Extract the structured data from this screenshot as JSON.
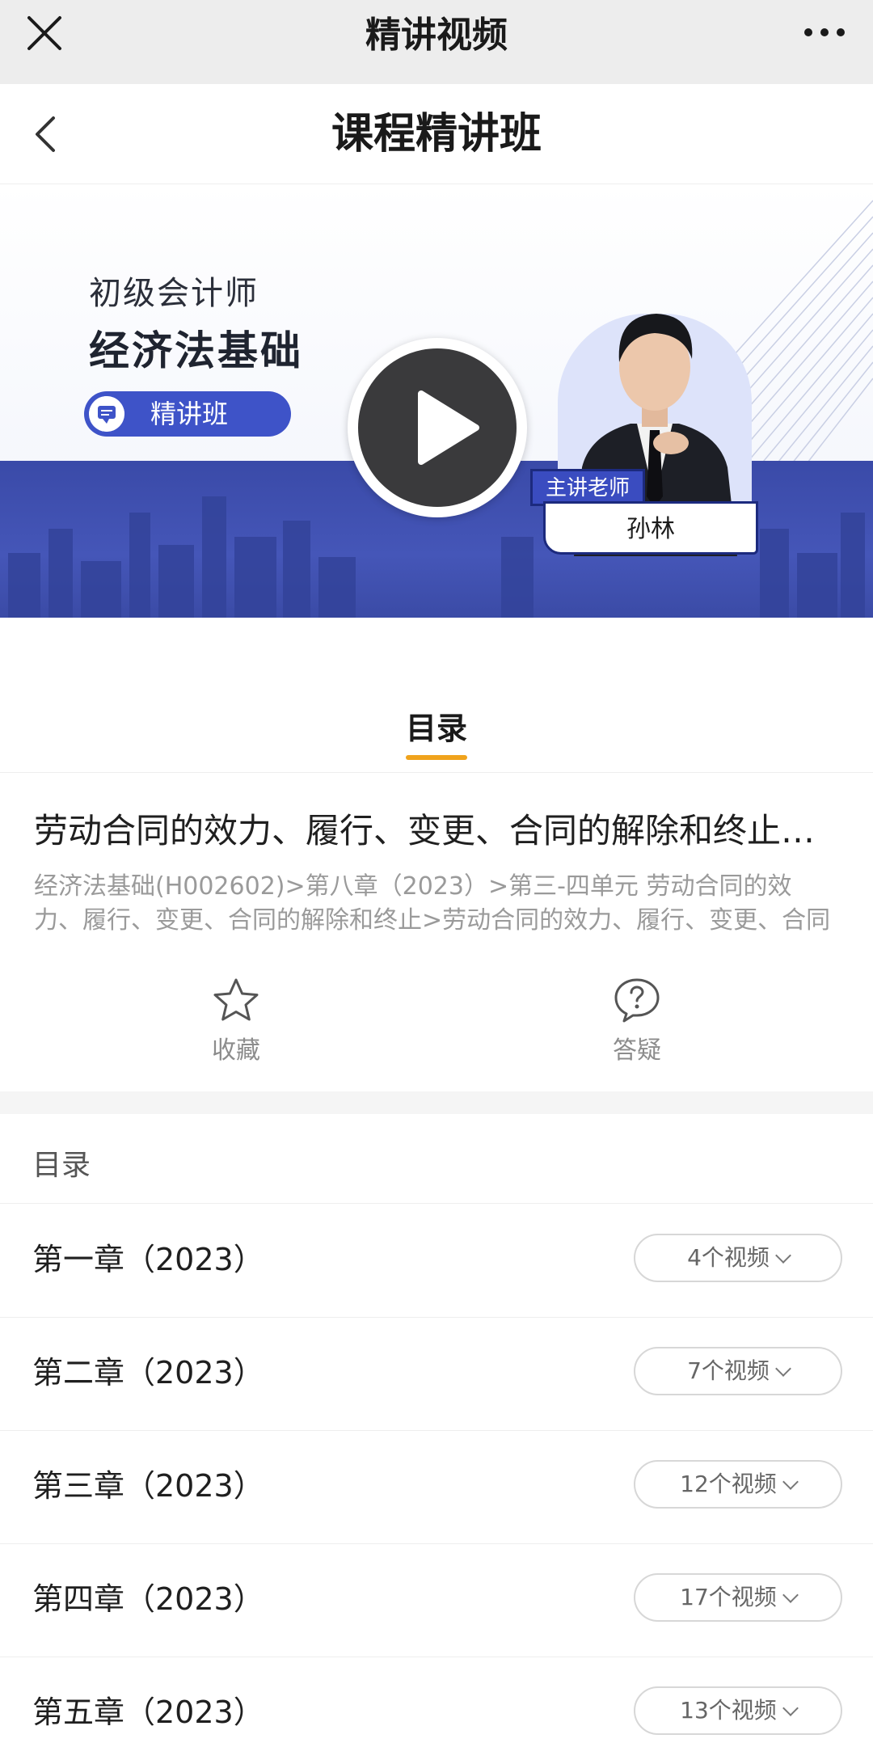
{
  "wechat_bar": {
    "title": "精讲视频"
  },
  "header": {
    "title": "课程精讲班"
  },
  "banner": {
    "subtitle": "初级会计师",
    "main_title": "经济法基础",
    "pill_label": "精讲班",
    "teacher_tag": "主讲老师",
    "teacher_name": "孙林",
    "colors": {
      "band": "#3e4fb0",
      "pill": "#3e53c8"
    }
  },
  "tab": {
    "label": "目录",
    "accent": "#f0a31c"
  },
  "lesson": {
    "title": "劳动合同的效力、履行、变更、合同的解除和终止…",
    "path": "经济法基础(H002602)>第八章（2023）>第三-四单元 劳动合同的效力、履行、变更、合同的解除和终止>劳动合同的效力、履行、变更、合同的解…"
  },
  "actions": {
    "favorite": {
      "label": "收藏",
      "icon": "star-icon"
    },
    "question": {
      "label": "答疑",
      "icon": "question-icon"
    }
  },
  "toc": {
    "heading": "目录",
    "chapters": [
      {
        "title": "第一章（2023）",
        "count": "4个视频"
      },
      {
        "title": "第二章（2023）",
        "count": "7个视频"
      },
      {
        "title": "第三章（2023）",
        "count": "12个视频"
      },
      {
        "title": "第四章（2023）",
        "count": "17个视频"
      },
      {
        "title": "第五章（2023）",
        "count": "13个视频"
      }
    ]
  }
}
